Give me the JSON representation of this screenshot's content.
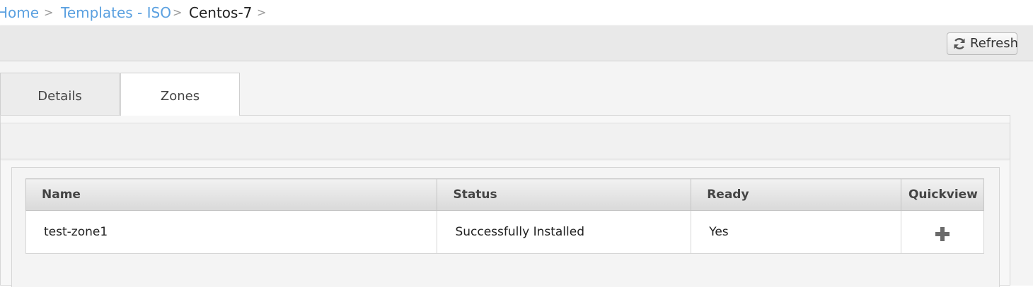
{
  "breadcrumb": {
    "items": [
      {
        "label": "Home",
        "link": true
      },
      {
        "label": "Templates - ISO",
        "link": true
      },
      {
        "label": "Centos-7",
        "link": false
      }
    ],
    "separator": ">"
  },
  "toolbar": {
    "refresh_label": "Refresh",
    "refresh_icon": "refresh-icon"
  },
  "tabs": [
    {
      "label": "Details",
      "active": false
    },
    {
      "label": "Zones",
      "active": true
    }
  ],
  "table": {
    "columns": [
      "Name",
      "Status",
      "Ready",
      "Quickview"
    ],
    "rows": [
      {
        "name": "test-zone1",
        "status": "Successfully Installed",
        "ready": "Yes",
        "quickview_icon": "plus-icon"
      }
    ]
  },
  "colors": {
    "link": "#5aa0e0",
    "toolbar_bg": "#e9e9e9",
    "content_bg": "#f4f4f4"
  }
}
